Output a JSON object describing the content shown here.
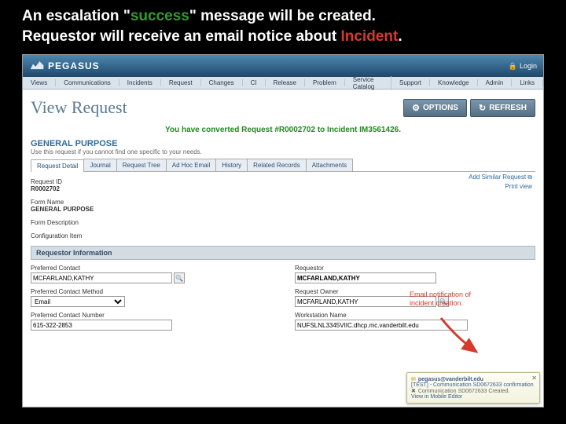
{
  "slide": {
    "line1a": "An escalation \"",
    "line1b": "success",
    "line1c": "\" message will be created.",
    "line2a": "Requestor will receive an email notice about ",
    "line2b": "Incident",
    "line2c": "."
  },
  "brand": "PEGASUS",
  "login": "Login",
  "menu": [
    "Views",
    "Communications",
    "Incidents",
    "Request",
    "Changes",
    "CI",
    "Release",
    "Problem",
    "Service Catalog",
    "Support",
    "Knowledge",
    "Admin",
    "Links"
  ],
  "page_title": "View Request",
  "btn_options": "OPTIONS",
  "btn_refresh": "REFRESH",
  "success_msg": "You have converted Request #R0002702 to Incident IM3561426.",
  "gp_title": "GENERAL PURPOSE",
  "gp_sub": "Use this request if you cannot find one specific to your needs.",
  "tabs": [
    "Request Detail",
    "Journal",
    "Request Tree",
    "Ad Hoc Email",
    "History",
    "Related Records",
    "Attachments"
  ],
  "right_links": {
    "add": "Add Similar Request",
    "print": "Print view"
  },
  "fields": {
    "req_id_lbl": "Request ID",
    "req_id_val": "R0002702",
    "form_name_lbl": "Form Name",
    "form_name_val": "GENERAL PURPOSE",
    "form_desc_lbl": "Form Description",
    "ci_lbl": "Configuration Item"
  },
  "section_requestor": "Requestor Information",
  "req": {
    "pref_contact_lbl": "Preferred Contact",
    "pref_contact_val": "MCFARLAND,KATHY",
    "pref_method_lbl": "Preferred Contact Method",
    "pref_method_val": "Email",
    "pref_num_lbl": "Preferred Contact Number",
    "pref_num_val": "615-322-2853",
    "requestor_lbl": "Requestor",
    "requestor_val": "MCFARLAND,KATHY",
    "owner_lbl": "Request Owner",
    "owner_val": "MCFARLAND,KATHY",
    "ws_lbl": "Workstation Name",
    "ws_val": "NUFSLNL3345VIIC.dhcp.mc.vanderbilt.edu"
  },
  "annotation": "Email notification of incident creation.",
  "toast": {
    "from": "pegasus@vanderbilt.edu",
    "subj": "[TEST] - Communication SD0672633 confirmation",
    "body": "Communication SD0672633 Created.",
    "mobile": "View in Mobile Editor"
  }
}
